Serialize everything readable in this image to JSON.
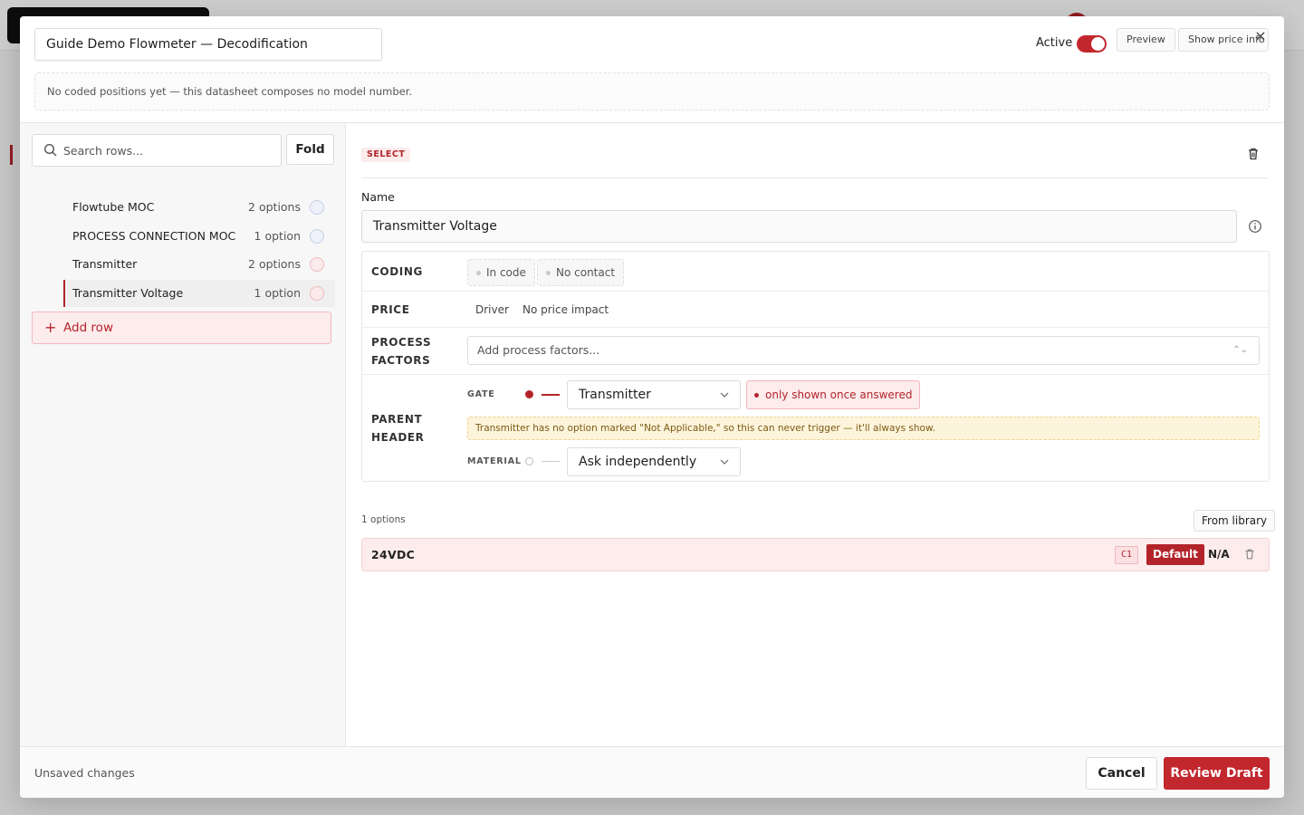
{
  "header": {
    "title_value": "Guide Demo Flowmeter — Decodification",
    "active_label": "Active",
    "active": true,
    "preview_label": "Preview",
    "show_price_label": "Show price info",
    "close_icon": "close-icon",
    "notice": "No coded positions yet — this datasheet composes no model number."
  },
  "sidebar": {
    "search_placeholder": "Search rows...",
    "fold_label": "Fold",
    "items": [
      {
        "label": "Flowtube MOC",
        "count": "2 options",
        "link": "link-icon",
        "selected": false
      },
      {
        "label": "PROCESS CONNECTION MOC",
        "count": "1 option",
        "link": "link-icon",
        "selected": false
      },
      {
        "label": "Transmitter",
        "count": "2 options",
        "link": "link-icon",
        "selected": false
      },
      {
        "label": "Transmitter Voltage",
        "count": "1 option",
        "link": "link-icon",
        "selected": true
      }
    ],
    "add_row_label": "Add row"
  },
  "editor": {
    "type_badge": "SELECT",
    "name_label": "Name",
    "name_value": "Transmitter Voltage",
    "coding": {
      "label": "CODING",
      "chips": [
        "In code",
        "No contact"
      ]
    },
    "price": {
      "label": "PRICE",
      "driver": "Driver",
      "impact": "No price impact"
    },
    "process_factors": {
      "label_line1": "PROCESS",
      "label_line2": "FACTORS",
      "placeholder": "Add process factors..."
    },
    "parent_header": {
      "label_line1": "PARENT",
      "label_line2": "HEADER",
      "gate_label": "GATE",
      "gate_value": "Transmitter",
      "gate_badge": "only shown once answered",
      "warning": "Transmitter has no option marked \"Not Applicable,\" so this can never trigger — it'll always show.",
      "material_label": "MATERIAL",
      "material_value": "Ask independently"
    },
    "options_count": "1 options",
    "from_library_label": "From library",
    "options": [
      {
        "name": "24VDC",
        "code": "C1",
        "default_label": "Default",
        "na_label": "N/A"
      }
    ]
  },
  "footer": {
    "status": "Unsaved changes",
    "cancel_label": "Cancel",
    "review_label": "Review Draft"
  },
  "colors": {
    "accent": "#c3272e",
    "accent_soft": "#fdecec",
    "warning_bg": "#fdf4dc"
  }
}
